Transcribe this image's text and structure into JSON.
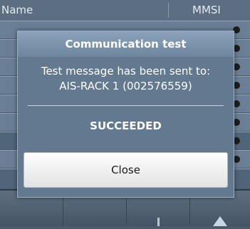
{
  "list": {
    "col_name": "Name",
    "col_mmsi": "MMSI"
  },
  "dialog": {
    "title": "Communication test",
    "message_line1": "Test message has been sent to:",
    "message_line2": "AIS-RACK 1 (002576559)",
    "status": "SUCCEEDED",
    "close_label": "Close"
  }
}
